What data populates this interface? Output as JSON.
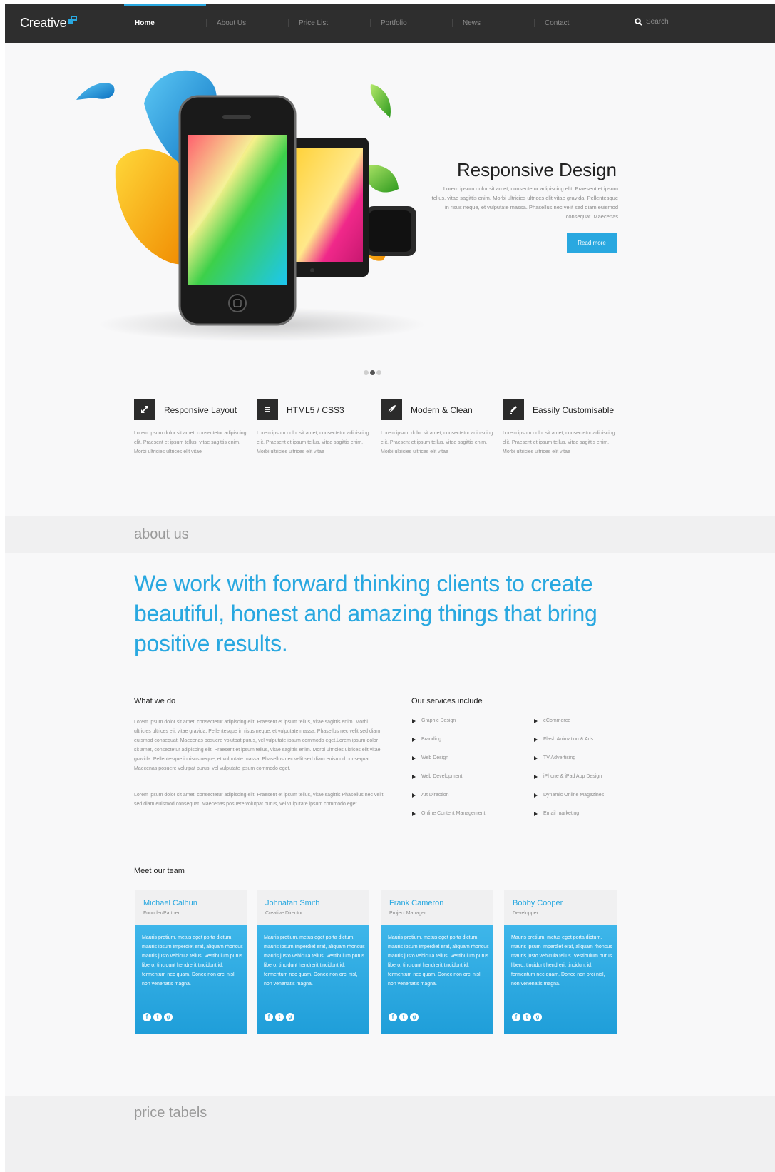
{
  "brand": {
    "name": "Creative",
    "accent": "#29a8e0",
    "nav_bg": "#2e2e2e"
  },
  "nav": {
    "items": [
      {
        "label": "Home",
        "active": true
      },
      {
        "label": "About Us"
      },
      {
        "label": "Price List"
      },
      {
        "label": "Portfolio"
      },
      {
        "label": "News"
      },
      {
        "label": "Contact"
      }
    ],
    "search_label": "Search",
    "search_icon": "search-icon"
  },
  "hero": {
    "title": "Responsive Design",
    "text": "Lorem ipsum dolor sit amet, consectetur adipiscing elit. Praesent et ipsum tellus, vitae sagittis enim. Morbi ultricies ultrices elit vitae gravida. Pellentesque in risus neque, et vulputate massa. Phasellus nec velit sed diam euismod consequat. Maecenas",
    "button": "Read more",
    "slides": 3,
    "active_slide": 2
  },
  "features": [
    {
      "title": "Responsive Layout",
      "icon": "expand-icon",
      "text": "Lorem ipsum dolor sit amet, consectetur adipiscing elit. Praesent et ipsum tellus, vitae sagittis enim. Morbi ultricies ultrices elit vitae"
    },
    {
      "title": "HTML5 / CSS3",
      "icon": "menu-lines-icon",
      "text": "Lorem ipsum dolor sit amet, consectetur adipiscing elit. Praesent et ipsum tellus, vitae sagittis enim. Morbi ultricies ultrices elit vitae"
    },
    {
      "title": "Modern & Clean",
      "icon": "feather-icon",
      "text": "Lorem ipsum dolor sit amet, consectetur adipiscing elit. Praesent et ipsum tellus, vitae sagittis enim. Morbi ultricies ultrices elit vitae"
    },
    {
      "title": "Eassily Customisable",
      "icon": "pen-icon",
      "text": "Lorem ipsum dolor sit amet, consectetur adipiscing elit. Praesent et ipsum tellus, vitae sagittis enim. Morbi ultricies ultrices elit vitae"
    }
  ],
  "about": {
    "heading": "about us",
    "quote": "We work with forward thinking clients to create beautiful, honest and amazing things that bring positive results."
  },
  "what_we_do": {
    "heading": "What we do",
    "para1": "Lorem ipsum dolor sit amet, consectetur adipiscing elit. Praesent et ipsum tellus, vitae sagittis enim. Morbi ultricies ultrices elit vitae gravida. Pellentesque in risus neque, et vulputate massa. Phasellus nec velit sed diam euismod consequat. Maecenas posuere volutpat purus, vel vulputate ipsum commodo eget.Lorem ipsum dolor sit amet, consectetur adipiscing elit. Praesent et ipsum tellus, vitae sagittis enim. Morbi ultricies ultrices elit vitae gravida. Pellentesque in risus neque, et vulputate massa. Phasellus nec velit sed diam euismod consequat. Maecenas posuere volutpat purus, vel vulputate ipsum commodo eget.",
    "para2": "Lorem ipsum dolor sit amet, consectetur adipiscing elit. Praesent et ipsum tellus, vitae sagittis Phasellus nec velit sed diam euismod consequat. Maecenas posuere volutpat purus, vel vulputate ipsum commodo eget."
  },
  "services": {
    "heading": "Our services include",
    "col1": [
      "Graphic Design",
      "Branding",
      "Web Design",
      "Web Development",
      "Art Direction",
      "Online Content Management"
    ],
    "col2": [
      "eCommerce",
      "Flash Animation & Ads",
      "TV Advertising",
      "iPhone & iPad App Design",
      "Dynamic Online Magazines",
      "Email marketing"
    ]
  },
  "team": {
    "heading": "Meet our team",
    "members": [
      {
        "name": "Michael Calhun",
        "role": "Founder/Partner",
        "bio": "Mauris pretium, metus eget porta dictum, mauris ipsum imperdiet erat, aliquam rhoncus mauris justo vehicula tellus. Vestibulum purus libero, tincidunt hendrerit tincidunt id, fermentum nec quam. Donec non orci nisl, non venenatis magna."
      },
      {
        "name": "Johnatan Smith",
        "role": "Creative Director",
        "bio": "Mauris pretium, metus eget porta dictum, mauris ipsum imperdiet erat, aliquam rhoncus mauris justo vehicula tellus. Vestibulum purus libero, tincidunt hendrerit tincidunt id, fermentum nec quam. Donec non orci nisl, non venenatis magna."
      },
      {
        "name": "Frank Cameron",
        "role": "Project Manager",
        "bio": "Mauris pretium, metus eget porta dictum, mauris ipsum imperdiet erat, aliquam rhoncus mauris justo vehicula tellus. Vestibulum purus libero, tincidunt hendrerit tincidunt id, fermentum nec quam. Donec non orci nisl, non venenatis magna."
      },
      {
        "name": "Bobby Cooper",
        "role": "Developper",
        "bio": "Mauris pretium, metus eget porta dictum, mauris ipsum imperdiet erat, aliquam rhoncus mauris justo vehicula tellus. Vestibulum purus libero, tincidunt hendrerit tincidunt id, fermentum nec quam. Donec non orci nisl, non venenatis magna."
      }
    ],
    "social_icons": [
      "facebook-icon",
      "twitter-icon",
      "google-plus-icon"
    ],
    "social_glyphs": [
      "f",
      "t",
      "g"
    ]
  },
  "price": {
    "heading": "price tabels"
  }
}
